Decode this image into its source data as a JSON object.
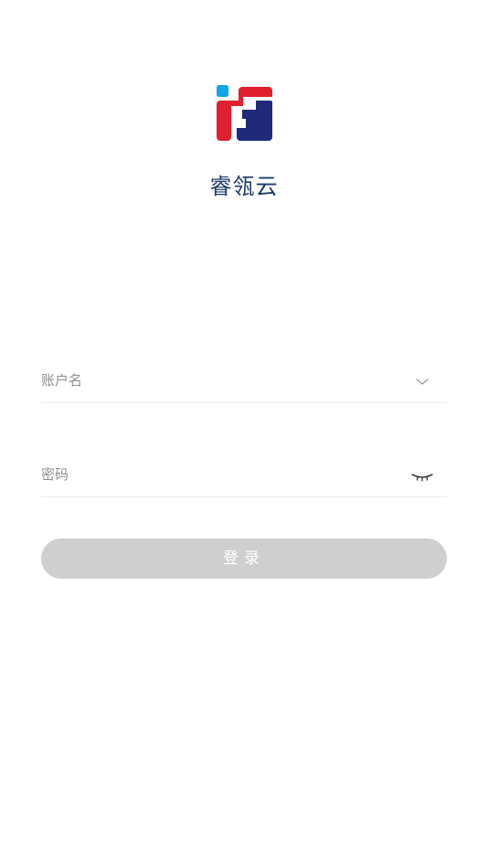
{
  "app": {
    "name": "睿瓴云",
    "logo_icon": "rl-brand-logo-icon"
  },
  "form": {
    "account": {
      "placeholder": "账户名",
      "value": "",
      "dropdown_icon": "chevron-down-icon"
    },
    "password": {
      "placeholder": "密码",
      "value": "",
      "visibility_icon": "eye-closed-icon"
    },
    "login_label": "登录"
  },
  "colors": {
    "brand_red": "#e0202e",
    "brand_navy": "#1f2a7a",
    "brand_blue": "#10a7e6",
    "title": "#1f3a6b",
    "button_disabled": "#cfcfcf",
    "placeholder": "#8e8e8e",
    "divider": "#ebebeb"
  }
}
